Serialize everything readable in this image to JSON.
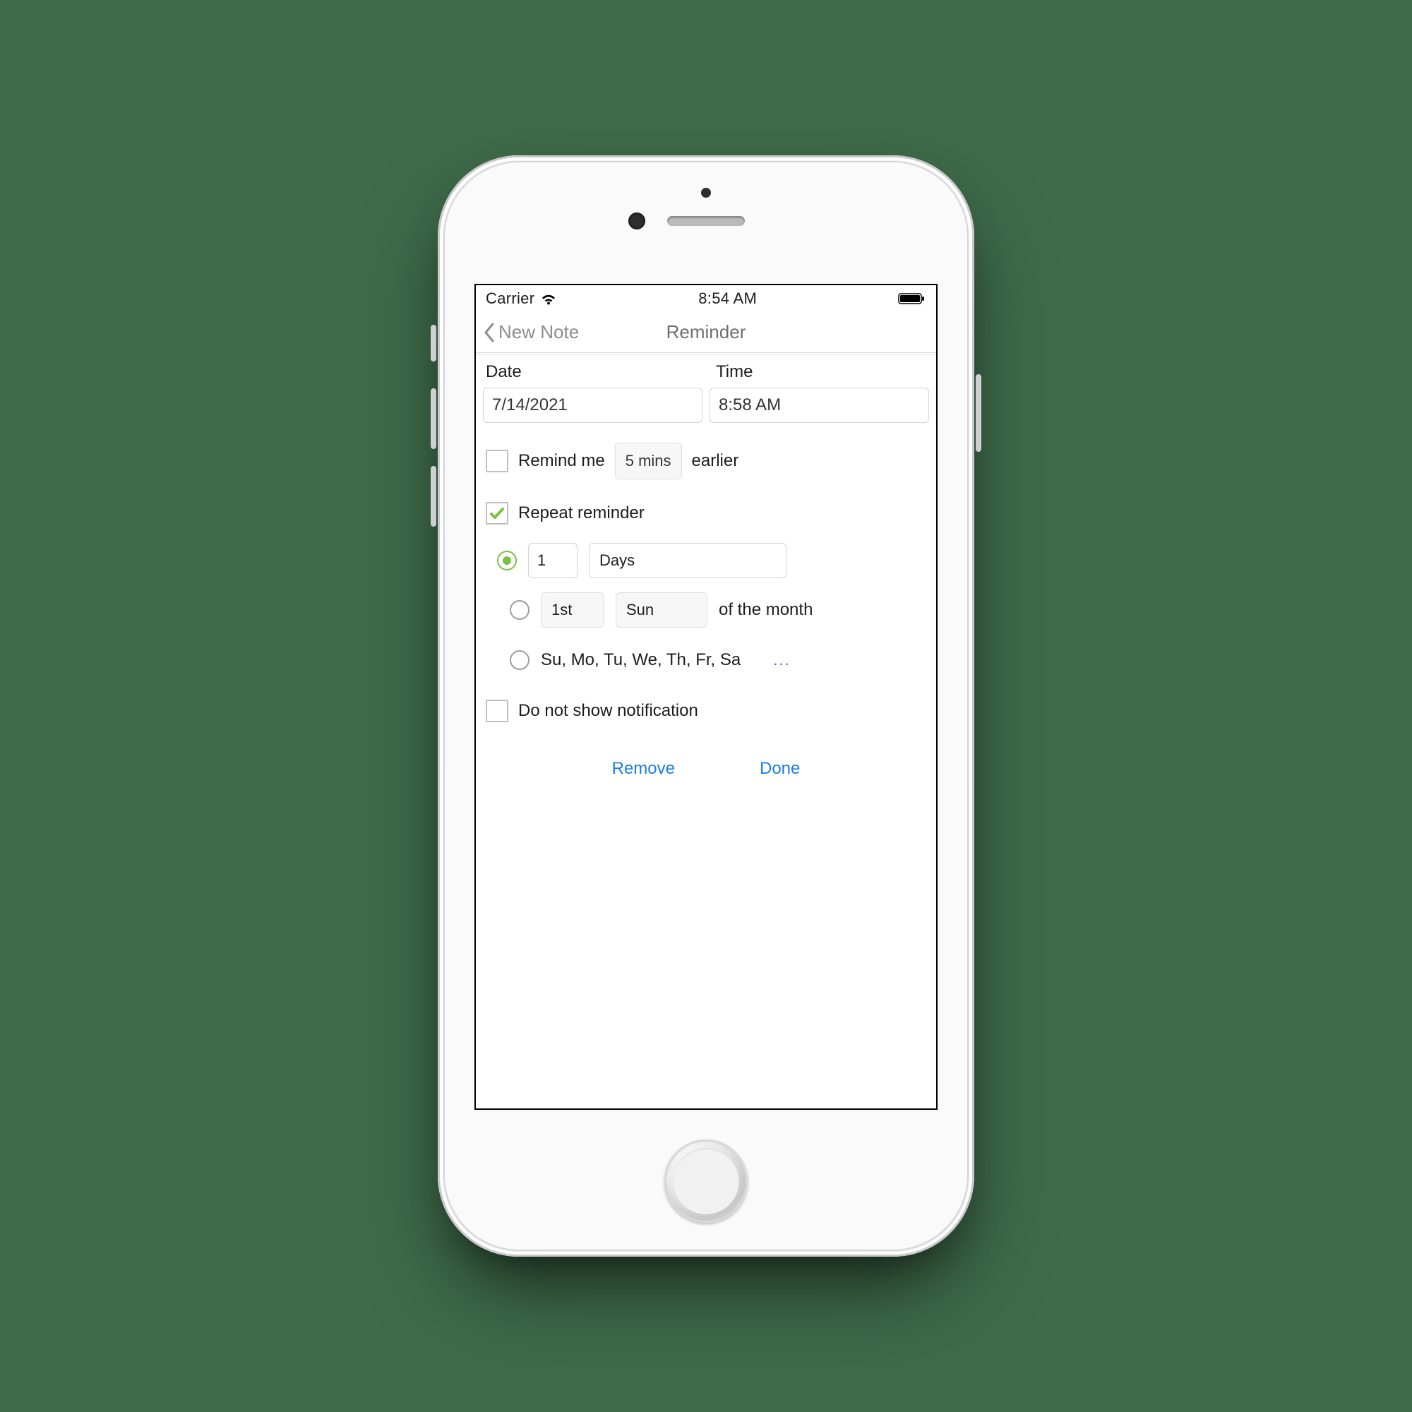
{
  "status": {
    "carrier": "Carrier",
    "time": "8:54 AM"
  },
  "nav": {
    "back_label": "New Note",
    "title": "Reminder"
  },
  "fields": {
    "date_label": "Date",
    "time_label": "Time",
    "date_value": "7/14/2021",
    "time_value": "8:58 AM"
  },
  "remind_earlier": {
    "checked": false,
    "prefix": "Remind me",
    "interval": "5 mins",
    "suffix": "earlier"
  },
  "repeat": {
    "checked": true,
    "label": "Repeat reminder",
    "option_interval": {
      "selected": true,
      "count": "1",
      "unit": "Days"
    },
    "option_monthly": {
      "selected": false,
      "ordinal": "1st",
      "weekday": "Sun",
      "suffix": "of the month"
    },
    "option_weekdays": {
      "selected": false,
      "days": "Su, Mo, Tu, We, Th, Fr, Sa",
      "more": "..."
    }
  },
  "no_notification": {
    "checked": false,
    "label": "Do not show notification"
  },
  "actions": {
    "remove": "Remove",
    "done": "Done"
  }
}
